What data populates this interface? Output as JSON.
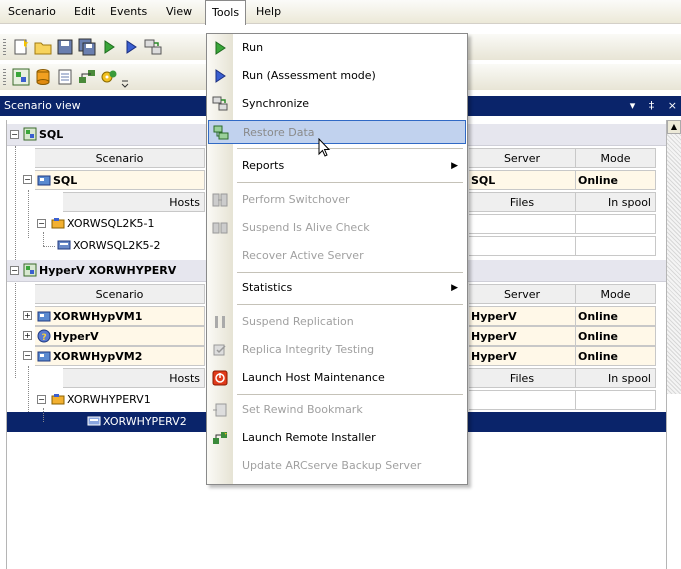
{
  "menubar": {
    "items": [
      {
        "label": "Scenario"
      },
      {
        "label": "Edit"
      },
      {
        "label": "Events"
      },
      {
        "label": "View"
      },
      {
        "label": "Tools",
        "active": true
      },
      {
        "label": "Help"
      }
    ]
  },
  "panel": {
    "title": "Scenario view",
    "controls": [
      "▾",
      "‡",
      "×"
    ]
  },
  "groups": [
    {
      "name": "SQL",
      "scenario_header": {
        "scenario": "Scenario",
        "server": "Server",
        "mode": "Mode"
      },
      "scenarios": [
        {
          "name": "SQL",
          "server": "SQL",
          "mode": "Online"
        }
      ],
      "hosts_header": {
        "hosts": "Hosts",
        "files": "Files",
        "in_spool": "In spool"
      },
      "hosts": [
        "XORWSQL2K5-1",
        "XORWSQL2K5-2"
      ]
    },
    {
      "name": "HyperV XORWHYPERV",
      "scenario_header": {
        "scenario": "Scenario",
        "server": "Server",
        "mode": "Mode"
      },
      "scenarios": [
        {
          "name": "XORWHypVM1",
          "server": "HyperV",
          "mode": "Online"
        },
        {
          "name": "HyperV",
          "server": "HyperV",
          "mode": "Online"
        },
        {
          "name": "XORWHypVM2",
          "server": "HyperV",
          "mode": "Online"
        }
      ],
      "hosts_header": {
        "hosts": "Hosts",
        "files": "Files",
        "in_spool": "In spool"
      },
      "hosts": [
        "XORWHYPERV1",
        "XORWHYPERV2"
      ]
    }
  ],
  "tools_menu": {
    "items": [
      {
        "label": "Run",
        "icon": "play-green-icon",
        "enabled": true
      },
      {
        "label": "Run (Assessment mode)",
        "icon": "play-blue-icon",
        "enabled": true
      },
      {
        "label": "Synchronize",
        "icon": "synchronize-icon",
        "enabled": true
      },
      {
        "label": "Restore Data",
        "icon": "restore-data-icon",
        "enabled": false,
        "hover": true
      },
      {
        "label": "Reports",
        "submenu": true,
        "enabled": true
      },
      {
        "label": "Perform Switchover",
        "icon": "switchover-icon",
        "enabled": false
      },
      {
        "label": "Suspend Is Alive Check",
        "icon": "suspend-check-icon",
        "enabled": false
      },
      {
        "label": "Recover Active Server",
        "enabled": false
      },
      {
        "label": "Statistics",
        "submenu": true,
        "enabled": true
      },
      {
        "label": "Suspend Replication",
        "icon": "pause-icon",
        "enabled": false
      },
      {
        "label": "Replica Integrity Testing",
        "icon": "integrity-test-icon",
        "enabled": false
      },
      {
        "label": "Launch Host Maintenance",
        "icon": "host-maintenance-icon",
        "enabled": true
      },
      {
        "label": "Set Rewind Bookmark",
        "icon": "bookmark-icon",
        "enabled": false
      },
      {
        "label": "Launch Remote Installer",
        "icon": "remote-installer-icon",
        "enabled": true
      },
      {
        "label": "Update ARCserve Backup Server",
        "enabled": false
      }
    ]
  }
}
